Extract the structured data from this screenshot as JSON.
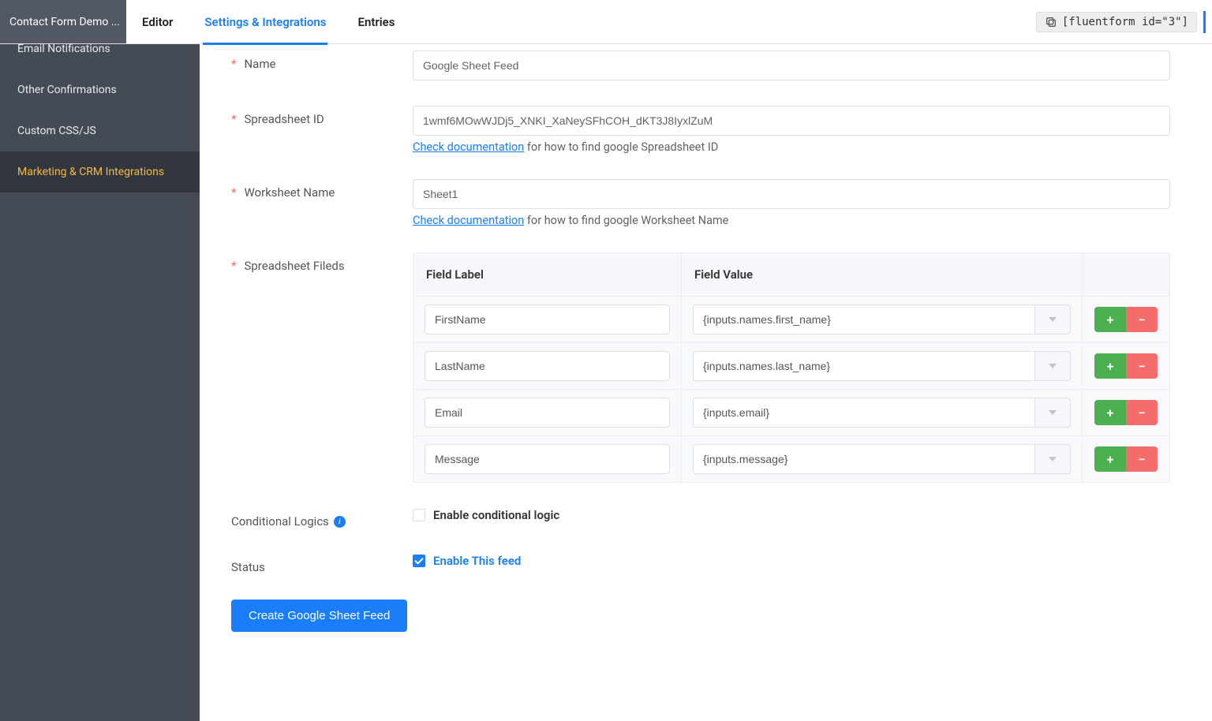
{
  "header": {
    "form_name": "Contact Form Demo ...",
    "tabs": {
      "editor": "Editor",
      "settings": "Settings & Integrations",
      "entries": "Entries"
    },
    "shortcode": "[fluentform id=\"3\"]"
  },
  "sidebar": {
    "email_notifications": "Email Notifications",
    "other_confirmations": "Other Confirmations",
    "custom_css_js": "Custom CSS/JS",
    "marketing_crm": "Marketing & CRM Integrations"
  },
  "form": {
    "name_label": "Name",
    "name_value": "Google Sheet Feed",
    "spreadsheet_id_label": "Spreadsheet ID",
    "spreadsheet_id_value": "1wmf6MOwWJDj5_XNKI_XaNeySFhCOH_dKT3J8IyxlZuM",
    "spreadsheet_id_help_link": "Check documentation",
    "spreadsheet_id_help_text": " for how to find google Spreadsheet ID",
    "worksheet_name_label": "Worksheet Name",
    "worksheet_name_value": "Sheet1",
    "worksheet_name_help_link": "Check documentation",
    "worksheet_name_help_text": " for how to find google Worksheet Name",
    "fields_label": "Spreadsheet Fileds",
    "fields_header_label": "Field Label",
    "fields_header_value": "Field Value",
    "fields": [
      {
        "label": "FirstName",
        "value": "{inputs.names.first_name}"
      },
      {
        "label": "LastName",
        "value": "{inputs.names.last_name}"
      },
      {
        "label": "Email",
        "value": "{inputs.email}"
      },
      {
        "label": "Message",
        "value": "{inputs.message}"
      }
    ],
    "conditional_label": "Conditional Logics",
    "conditional_checkbox": "Enable conditional logic",
    "status_label": "Status",
    "status_checkbox": "Enable This feed",
    "submit_button": "Create Google Sheet Feed"
  },
  "glyph": {
    "plus": "+",
    "minus": "−"
  }
}
